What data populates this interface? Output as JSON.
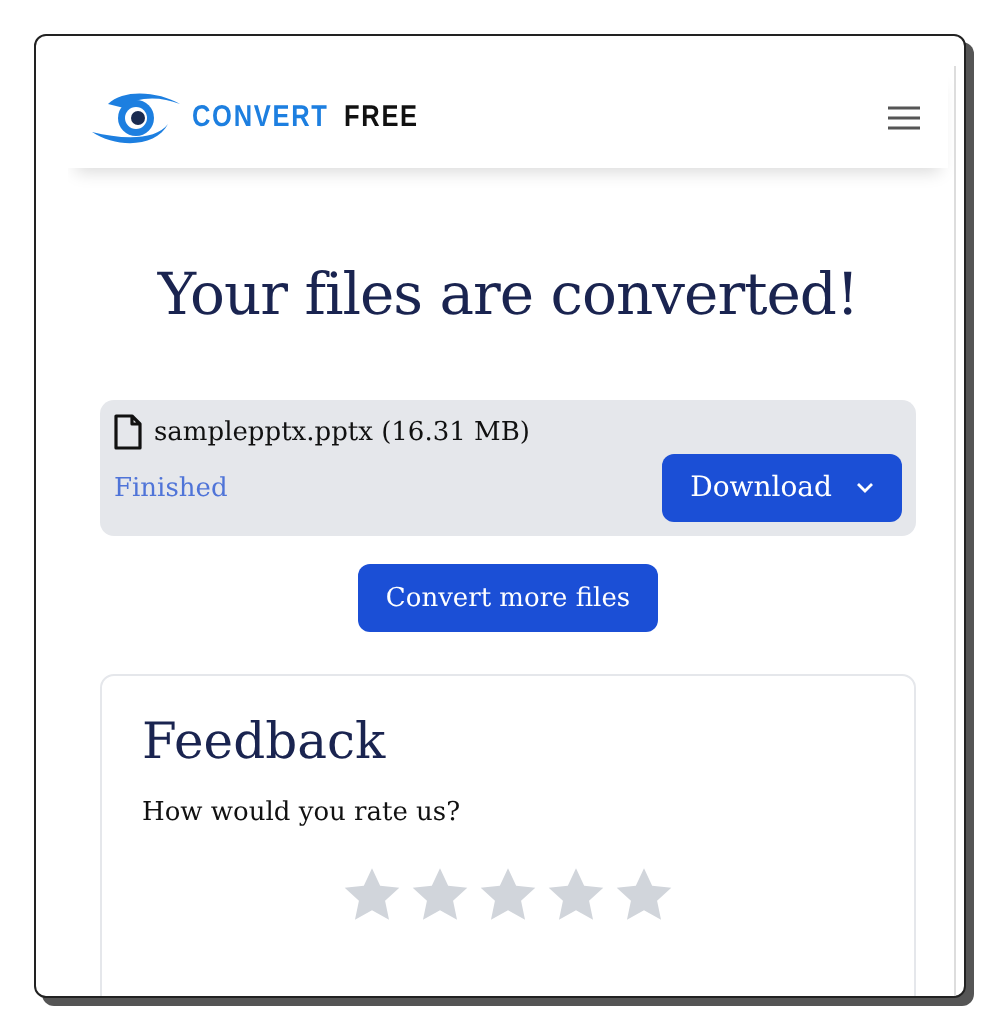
{
  "header": {
    "logo_parts": [
      "CONVERT",
      "FREE"
    ]
  },
  "title": "Your files are converted!",
  "file": {
    "name": "samplepptx.pptx (16.31 MB)",
    "status": "Finished",
    "download_label": "Download"
  },
  "convert_more_label": "Convert more files",
  "feedback": {
    "title": "Feedback",
    "question": "How would you rate us?",
    "stars": 0
  }
}
